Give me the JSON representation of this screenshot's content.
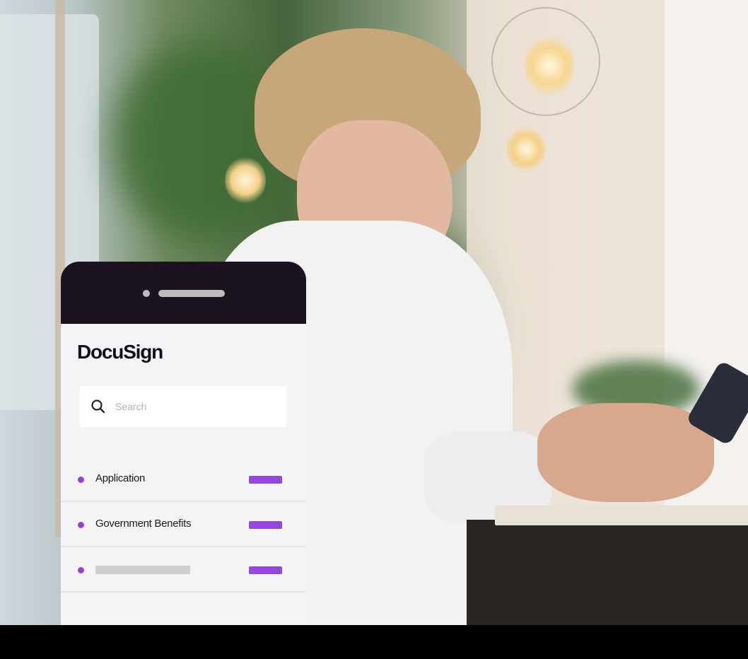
{
  "phone": {
    "brand": "DocuSign",
    "search": {
      "placeholder": "Search",
      "value": ""
    },
    "list": {
      "items": [
        {
          "label": "Application"
        },
        {
          "label": "Government Benefits"
        },
        {
          "label": ""
        }
      ]
    }
  },
  "colors": {
    "phone_top": "#1b1420",
    "accent_purple": "#9447da",
    "bullet_purple": "#9b3fd6"
  },
  "icons": [
    "search-icon"
  ]
}
